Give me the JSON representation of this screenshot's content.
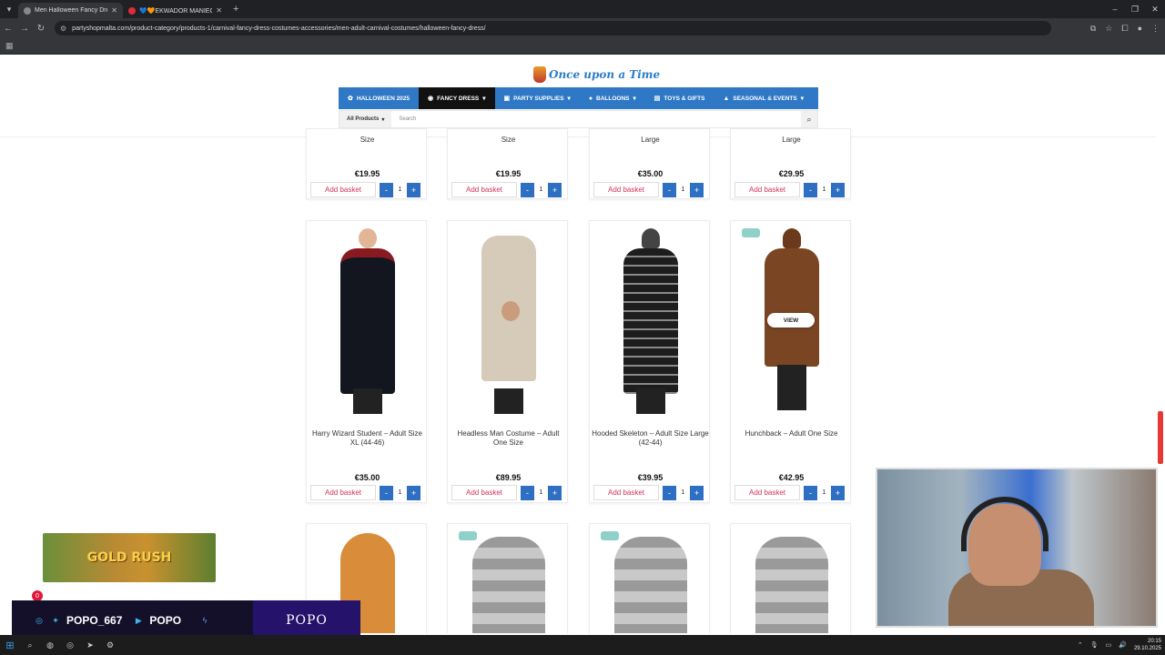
{
  "browser": {
    "tabs": [
      {
        "title": "Men Halloween Fancy Dress | C",
        "active": true
      },
      {
        "title": "💙🧡EKWADOR MANIEC",
        "active": false
      }
    ],
    "url": "partyshopmalta.com/product-category/products-1/carnival-fancy-dress-costumes-accessories/men-adult-carnival-costumes/halloween-fancy-dress/"
  },
  "site": {
    "logo_text": "Once upon a Time",
    "nav": [
      {
        "label": "HALLOWEEN 2025",
        "icon": "pumpkin-icon",
        "active": false
      },
      {
        "label": "FANCY DRESS",
        "icon": "mask-icon",
        "active": true
      },
      {
        "label": "PARTY SUPPLIES",
        "icon": "gift-icon",
        "active": false
      },
      {
        "label": "BALLOONS",
        "icon": "balloon-icon",
        "active": false
      },
      {
        "label": "TOYS & GIFTS",
        "icon": "toy-icon",
        "active": false
      },
      {
        "label": "SEASONAL & EVENTS",
        "icon": "tree-icon",
        "active": false
      }
    ],
    "search": {
      "category": "All Products",
      "placeholder": "Search"
    }
  },
  "products": {
    "row1": [
      {
        "name_tail": "Size",
        "price": "€19.95",
        "qty": "1"
      },
      {
        "name_tail": "Size",
        "price": "€19.95",
        "qty": "1"
      },
      {
        "name_tail": "Large",
        "price": "€35.00",
        "qty": "1"
      },
      {
        "name_tail": "Large",
        "price": "€29.95",
        "qty": "1"
      }
    ],
    "row2": [
      {
        "name": "Harry Wizard Student – Adult Size XL (44-46)",
        "price": "€35.00",
        "qty": "1"
      },
      {
        "name": "Headless Man Costume – Adult One Size",
        "price": "€89.95",
        "qty": "1"
      },
      {
        "name": "Hooded Skeleton – Adult Size Large (42-44)",
        "price": "€39.95",
        "qty": "1"
      },
      {
        "name": "Hunchback – Adult One Size",
        "price": "€42.95",
        "qty": "1",
        "view_label": "VIEW"
      }
    ],
    "add_label": "Add basket",
    "minus": "-",
    "plus": "+"
  },
  "overlay": {
    "promo_text": "GOLD RUSH",
    "social_handle": "POPO_667",
    "youtube_name": "POPO",
    "brand": "POPO",
    "notification_count": "0"
  },
  "taskbar": {
    "time": "20:15",
    "date": "29.10.2025"
  }
}
